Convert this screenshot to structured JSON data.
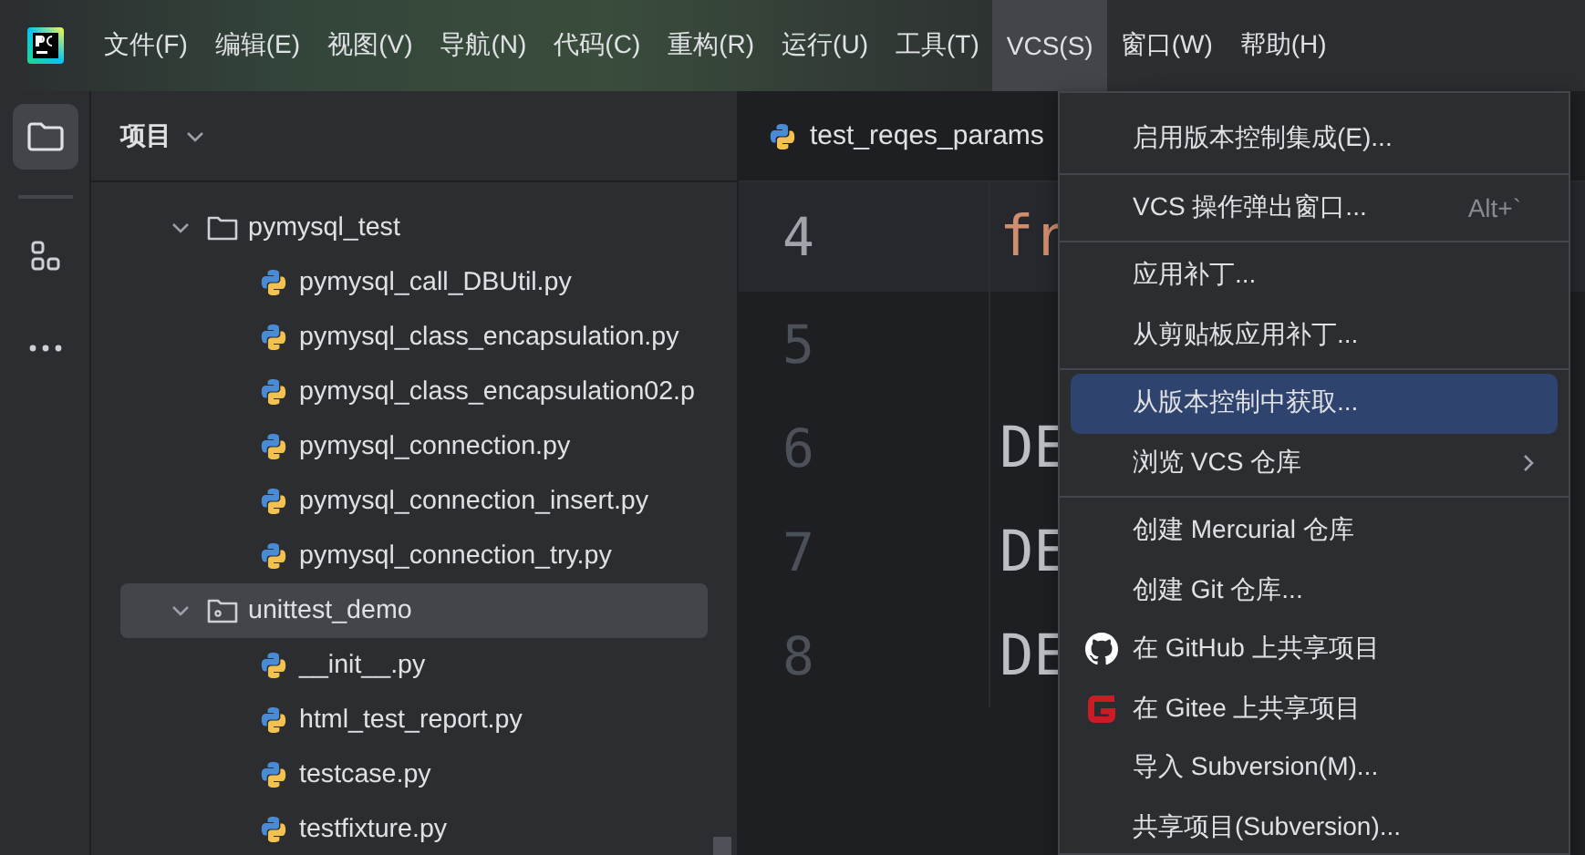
{
  "menubar": {
    "items": [
      {
        "label": "文件(F)",
        "selected": false
      },
      {
        "label": "编辑(E)",
        "selected": false
      },
      {
        "label": "视图(V)",
        "selected": false
      },
      {
        "label": "导航(N)",
        "selected": false
      },
      {
        "label": "代码(C)",
        "selected": false
      },
      {
        "label": "重构(R)",
        "selected": false
      },
      {
        "label": "运行(U)",
        "selected": false
      },
      {
        "label": "工具(T)",
        "selected": false
      },
      {
        "label": "VCS(S)",
        "selected": true
      },
      {
        "label": "窗口(W)",
        "selected": false
      },
      {
        "label": "帮助(H)",
        "selected": false
      }
    ]
  },
  "toolstrip": {
    "items": [
      {
        "kind": "folder",
        "selected": true
      },
      {
        "kind": "structure",
        "selected": false
      },
      {
        "kind": "more",
        "selected": false
      }
    ]
  },
  "project": {
    "title": "项目",
    "tree": [
      {
        "label": "pymysql_test",
        "kind": "folder",
        "expanded": true,
        "selected": false,
        "children": [
          {
            "label": "pymysql_call_DBUtil.py",
            "kind": "python",
            "selected": false
          },
          {
            "label": "pymysql_class_encapsulation.py",
            "kind": "python",
            "selected": false
          },
          {
            "label": "pymysql_class_encapsulation02.p",
            "kind": "python",
            "selected": false
          },
          {
            "label": "pymysql_connection.py",
            "kind": "python",
            "selected": false
          },
          {
            "label": "pymysql_connection_insert.py",
            "kind": "python",
            "selected": false
          },
          {
            "label": "pymysql_connection_try.py",
            "kind": "python",
            "selected": false
          }
        ]
      },
      {
        "label": "unittest_demo",
        "kind": "package",
        "expanded": true,
        "selected": true,
        "children": [
          {
            "label": "__init__.py",
            "kind": "python",
            "selected": false
          },
          {
            "label": "html_test_report.py",
            "kind": "python",
            "selected": false
          },
          {
            "label": "testcase.py",
            "kind": "python",
            "selected": false
          },
          {
            "label": "testfixture.py",
            "kind": "python",
            "selected": false
          }
        ]
      }
    ]
  },
  "editor": {
    "tabs": [
      {
        "label": "test_reqes_params",
        "selected": true
      }
    ],
    "lines": [
      {
        "number": "4",
        "code": "fr",
        "kind": "keyword",
        "current": true
      },
      {
        "number": "5",
        "current": false
      },
      {
        "number": "6",
        "code": "DE",
        "kind": "constant",
        "current": false
      },
      {
        "number": "7",
        "code": "DE",
        "kind": "constant",
        "current": false
      },
      {
        "number": "8",
        "code": "DE",
        "kind": "constant",
        "current": false
      }
    ]
  },
  "vcs_menu": {
    "groups": [
      [
        {
          "label": "启用版本控制集成(E)...",
          "kind": "plain",
          "submenu": false,
          "selected": false
        }
      ],
      [
        {
          "label": "VCS 操作弹出窗口...",
          "shortcut": "Alt+`",
          "kind": "plain",
          "submenu": false,
          "selected": false
        }
      ],
      [
        {
          "label": "应用补丁...",
          "kind": "plain",
          "submenu": false,
          "selected": false
        },
        {
          "label": "从剪贴板应用补丁...",
          "kind": "plain",
          "submenu": false,
          "selected": false
        }
      ],
      [
        {
          "label": "从版本控制中获取...",
          "kind": "plain",
          "submenu": false,
          "selected": true
        },
        {
          "label": "浏览 VCS 仓库",
          "kind": "plain",
          "submenu": true,
          "selected": false
        }
      ],
      [
        {
          "label": "创建 Mercurial 仓库",
          "kind": "plain",
          "submenu": false,
          "selected": false
        },
        {
          "label": "创建 Git 仓库...",
          "kind": "plain",
          "submenu": false,
          "selected": false
        },
        {
          "label": "在 GitHub 上共享项目",
          "kind": "github",
          "submenu": false,
          "selected": false
        },
        {
          "label": "在 Gitee 上共享项目",
          "kind": "gitee",
          "submenu": false,
          "selected": false
        },
        {
          "label": "导入 Subversion(M)...",
          "kind": "plain",
          "submenu": false,
          "selected": false
        },
        {
          "label": "共享项目(Subversion)...",
          "kind": "plain",
          "submenu": false,
          "selected": false
        }
      ]
    ]
  }
}
